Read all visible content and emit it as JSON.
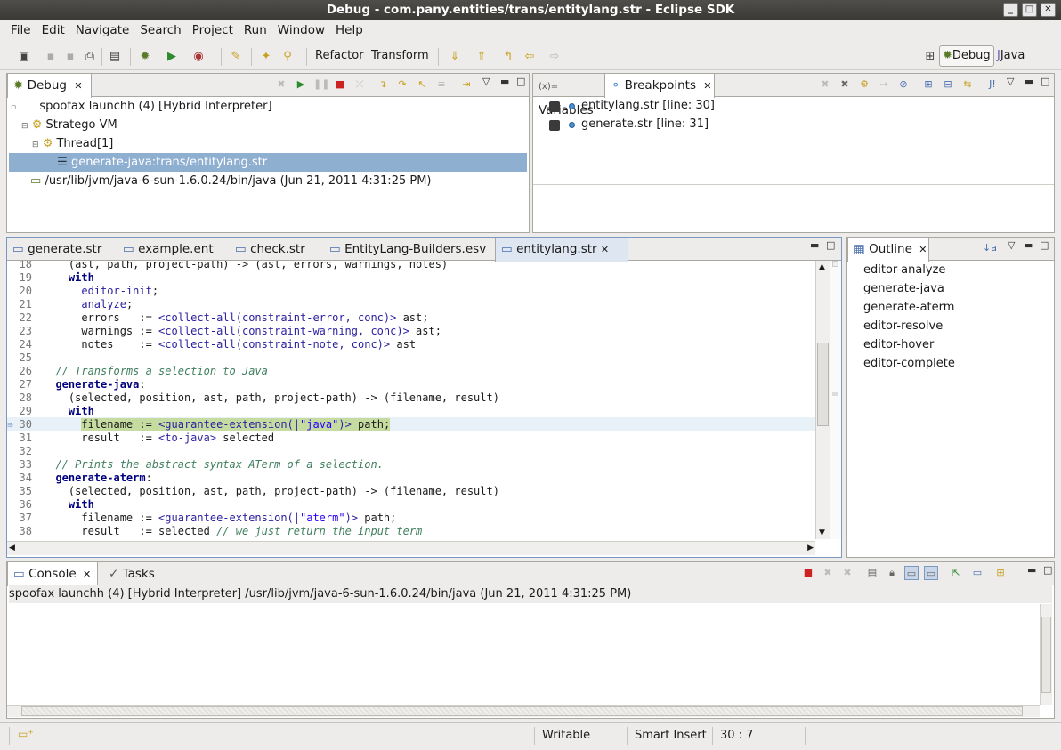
{
  "window": {
    "title": "Debug - com.pany.entities/trans/entitylang.str - Eclipse SDK"
  },
  "menu": [
    "File",
    "Edit",
    "Navigate",
    "Search",
    "Project",
    "Run",
    "Window",
    "Help"
  ],
  "toolbar": {
    "refactor": "Refactor",
    "transform": "Transform"
  },
  "perspectives": {
    "debug": "Debug",
    "java": "Java"
  },
  "debug_view": {
    "tab": "Debug",
    "rows": [
      "spoofax launchh (4) [Hybrid Interpreter]",
      "Stratego VM",
      "Thread[1]",
      "generate-java:trans/entitylang.str",
      "/usr/lib/jvm/java-6-sun-1.6.0.24/bin/java (Jun 21, 2011 4:31:25 PM)"
    ]
  },
  "variables_view": {
    "tab_variables": "Variables",
    "tab_breakpoints": "Breakpoints",
    "breakpoints": [
      "entitylang.str [line: 30]",
      "generate.str [line: 31]"
    ]
  },
  "editor": {
    "tabs": [
      "generate.str",
      "example.ent",
      "check.str",
      "EntityLang-Builders.esv",
      "entitylang.str"
    ],
    "lines": [
      {
        "n": "18",
        "t": "    (ast, path, project-path) -> (ast, errors, warnings, notes)"
      },
      {
        "n": "19",
        "t": "    with"
      },
      {
        "n": "20",
        "t": "      editor-init;"
      },
      {
        "n": "21",
        "t": "      analyze;"
      },
      {
        "n": "22",
        "t": "      errors   := <collect-all(constraint-error, conc)> ast;"
      },
      {
        "n": "23",
        "t": "      warnings := <collect-all(constraint-warning, conc)> ast;"
      },
      {
        "n": "24",
        "t": "      notes    := <collect-all(constraint-note, conc)> ast"
      },
      {
        "n": "25",
        "t": ""
      },
      {
        "n": "26",
        "t": "  // Transforms a selection to Java"
      },
      {
        "n": "27",
        "t": "  generate-java:"
      },
      {
        "n": "28",
        "t": "    (selected, position, ast, path, project-path) -> (filename, result)"
      },
      {
        "n": "29",
        "t": "    with"
      },
      {
        "n": "30",
        "t": "      filename := <guarantee-extension(|\"java\")> path;"
      },
      {
        "n": "31",
        "t": "      result   := <to-java> selected"
      },
      {
        "n": "32",
        "t": ""
      },
      {
        "n": "33",
        "t": "  // Prints the abstract syntax ATerm of a selection."
      },
      {
        "n": "34",
        "t": "  generate-aterm:"
      },
      {
        "n": "35",
        "t": "    (selected, position, ast, path, project-path) -> (filename, result)"
      },
      {
        "n": "36",
        "t": "    with"
      },
      {
        "n": "37",
        "t": "      filename := <guarantee-extension(|\"aterm\")> path;"
      },
      {
        "n": "38",
        "t": "      result   := selected // we just return the input term"
      }
    ]
  },
  "outline": {
    "tab": "Outline",
    "items": [
      "editor-analyze",
      "generate-java",
      "generate-aterm",
      "editor-resolve",
      "editor-hover",
      "editor-complete"
    ]
  },
  "console": {
    "tab_console": "Console",
    "tab_tasks": "Tasks",
    "header": "spoofax launchh (4) [Hybrid Interpreter] /usr/lib/jvm/java-6-sun-1.6.0.24/bin/java (Jun 21, 2011 4:31:25 PM)"
  },
  "status": {
    "writable": "Writable",
    "insert_mode": "Smart Insert",
    "position": "30 : 7"
  }
}
